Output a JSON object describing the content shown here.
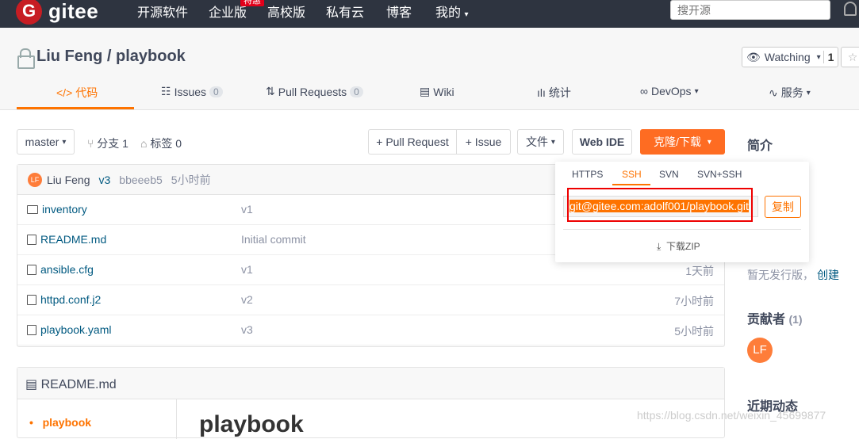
{
  "topbar": {
    "logo": "gitee",
    "nav": [
      "开源软件",
      "企业版",
      "高校版",
      "私有云",
      "博客",
      "我的"
    ],
    "badge": "特惠",
    "search_placeholder": "搜开源"
  },
  "repo": {
    "owner": "Liu Feng",
    "name": "playbook",
    "sep": " / ",
    "watch_label": "Watching",
    "watch_count": "1"
  },
  "tabs": [
    {
      "label": "代码"
    },
    {
      "label": "Issues",
      "count": "0"
    },
    {
      "label": "Pull Requests",
      "count": "0"
    },
    {
      "label": "Wiki"
    },
    {
      "label": "统计"
    },
    {
      "label": "DevOps"
    },
    {
      "label": "服务"
    }
  ],
  "toolbar": {
    "branch": "master",
    "branches": "分支 1",
    "tags": "标签 0",
    "pull_request": "+ Pull Request",
    "issue": "+ Issue",
    "file": "文件",
    "web_ide": "Web IDE",
    "clone": "克隆/下载"
  },
  "commit": {
    "avatar": "LF",
    "author": "Liu Feng",
    "version": "v3",
    "hash": "bbeeeb5",
    "time": "5小时前"
  },
  "files": [
    {
      "name": "inventory",
      "type": "dir",
      "message": "v1",
      "time": ""
    },
    {
      "name": "README.md",
      "type": "file",
      "message": "Initial commit",
      "time": ""
    },
    {
      "name": "ansible.cfg",
      "type": "file",
      "message": "v1",
      "time": "1天前"
    },
    {
      "name": "httpd.conf.j2",
      "type": "file",
      "message": "v2",
      "time": "7小时前"
    },
    {
      "name": "playbook.yaml",
      "type": "file",
      "message": "v3",
      "time": "5小时前"
    }
  ],
  "clone": {
    "tabs": [
      "HTTPS",
      "SSH",
      "SVN",
      "SVN+SSH"
    ],
    "active": "SSH",
    "url": "git@gitee.com:adolf001/playbook.git",
    "copy": "复制",
    "zip": "下载ZIP"
  },
  "sidebar": {
    "intro": "简介",
    "no_release": "暂无发行版，",
    "create": "创建",
    "contributors": "贡献者",
    "contributors_count": "(1)",
    "contributor_avatar": "LF",
    "activity": "近期动态"
  },
  "readme": {
    "header": "README.md",
    "toc_item": "playbook",
    "heading": "playbook"
  },
  "watermark": "https://blog.csdn.net/weixin_45699877"
}
